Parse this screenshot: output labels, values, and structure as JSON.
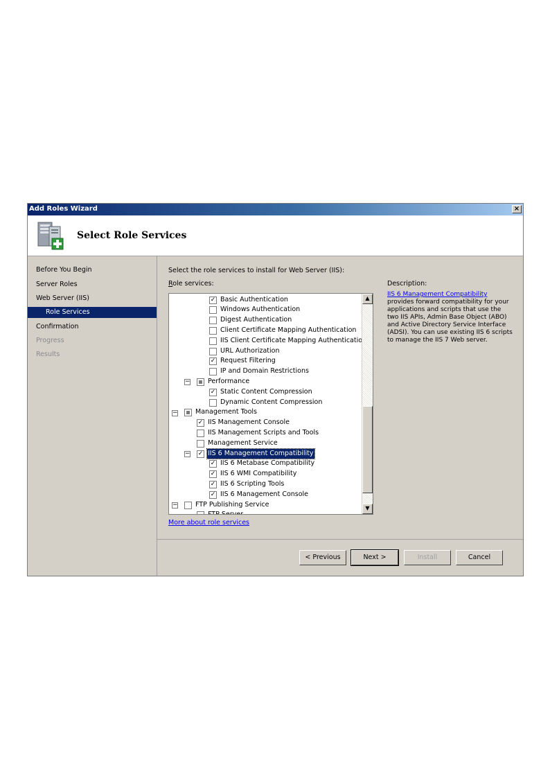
{
  "window": {
    "title": "Add Roles Wizard",
    "close_glyph": "×",
    "page_title": "Select Role Services",
    "header_icon": "server-add-icon"
  },
  "sidebar": {
    "items": [
      {
        "label": "Before You Begin",
        "state": "normal"
      },
      {
        "label": "Server Roles",
        "state": "normal"
      },
      {
        "label": "Web Server (IIS)",
        "state": "normal"
      },
      {
        "label": "Role Services",
        "state": "selected"
      },
      {
        "label": "Confirmation",
        "state": "normal"
      },
      {
        "label": "Progress",
        "state": "disabled"
      },
      {
        "label": "Results",
        "state": "disabled"
      }
    ]
  },
  "main": {
    "instruction": "Select the role services to install for Web Server (IIS):",
    "role_services_label": "Role services:",
    "tree": [
      {
        "label": "Basic Authentication",
        "level": 3,
        "checked": "checked",
        "expander": "none"
      },
      {
        "label": "Windows Authentication",
        "level": 3,
        "checked": "unchecked",
        "expander": "none"
      },
      {
        "label": "Digest Authentication",
        "level": 3,
        "checked": "unchecked",
        "expander": "none"
      },
      {
        "label": "Client Certificate Mapping Authentication",
        "level": 3,
        "checked": "unchecked",
        "expander": "none"
      },
      {
        "label": "IIS Client Certificate Mapping Authentication",
        "level": 3,
        "checked": "unchecked",
        "expander": "none"
      },
      {
        "label": "URL Authorization",
        "level": 3,
        "checked": "unchecked",
        "expander": "none"
      },
      {
        "label": "Request Filtering",
        "level": 3,
        "checked": "checked",
        "expander": "none"
      },
      {
        "label": "IP and Domain Restrictions",
        "level": 3,
        "checked": "unchecked",
        "expander": "none"
      },
      {
        "label": "Performance",
        "level": 2,
        "checked": "partial",
        "expander": "minus"
      },
      {
        "label": "Static Content Compression",
        "level": 3,
        "checked": "checked",
        "expander": "none"
      },
      {
        "label": "Dynamic Content Compression",
        "level": 3,
        "checked": "unchecked",
        "expander": "none"
      },
      {
        "label": "Management Tools",
        "level": 1,
        "checked": "partial",
        "expander": "minus"
      },
      {
        "label": "IIS Management Console",
        "level": 2,
        "checked": "checked",
        "expander": "none"
      },
      {
        "label": "IIS Management Scripts and Tools",
        "level": 2,
        "checked": "unchecked",
        "expander": "none"
      },
      {
        "label": "Management Service",
        "level": 2,
        "checked": "unchecked",
        "expander": "none"
      },
      {
        "label": "IIS 6 Management Compatibility",
        "level": 2,
        "checked": "checked",
        "expander": "minus",
        "selected": true
      },
      {
        "label": "IIS 6 Metabase Compatibility",
        "level": 3,
        "checked": "checked",
        "expander": "none"
      },
      {
        "label": "IIS 6 WMI Compatibility",
        "level": 3,
        "checked": "checked",
        "expander": "none"
      },
      {
        "label": "IIS 6 Scripting Tools",
        "level": 3,
        "checked": "checked",
        "expander": "none"
      },
      {
        "label": "IIS 6 Management Console",
        "level": 3,
        "checked": "checked",
        "expander": "none"
      },
      {
        "label": "FTP Publishing Service",
        "level": 1,
        "checked": "unchecked",
        "expander": "minus"
      },
      {
        "label": "FTP Server",
        "level": 2,
        "checked": "unchecked",
        "expander": "none"
      }
    ],
    "more_link": "More about role services"
  },
  "description": {
    "label": "Description:",
    "link": "IIS 6 Management Compatibility",
    "text": "provides forward compatibility for your applications and scripts that use the two IIS APIs, Admin Base Object (ABO) and Active Directory Service Interface (ADSI). You can use existing IIS 6 scripts to manage the IIS 7 Web server."
  },
  "footer": {
    "previous_label": "< Previous",
    "next_label": "Next >",
    "install_label": "Install",
    "cancel_label": "Cancel"
  },
  "scrollbar": {
    "up_glyph": "▲",
    "down_glyph": "▼"
  },
  "glyphs": {
    "check": "✓",
    "minus": "−"
  },
  "colors": {
    "selection": "#0a246a",
    "link": "#0000ee",
    "dialog_bg": "#d4d0c8"
  }
}
